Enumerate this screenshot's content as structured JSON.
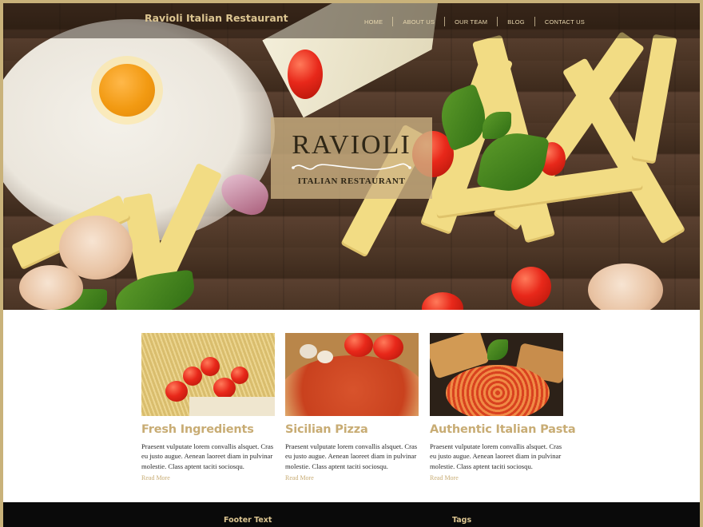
{
  "header": {
    "site_title": "Ravioli Italian Restaurant",
    "nav": [
      "HOME",
      "ABOUT US",
      "OUR TEAM",
      "BLOG",
      "CONTACT US"
    ]
  },
  "hero": {
    "logo_title": "RAVIOLI",
    "logo_subtitle": "ITALIAN RESTAURANT"
  },
  "cards": [
    {
      "title": "Fresh Ingredients",
      "text": "Praesent vulputate lorem convallis alsquet. Cras eu justo augue. Aenean laoreet diam in pulvinar molestie. Class aptent taciti sociosqu.",
      "link": "Read More"
    },
    {
      "title": "Sicilian Pizza",
      "text": "Praesent vulputate lorem convallis alsquet. Cras eu justo augue. Aenean laoreet diam in pulvinar molestie. Class aptent taciti sociosqu.",
      "link": "Read More"
    },
    {
      "title": "Authentic Italian Pasta",
      "text": "Praesent vulputate lorem convallis alsquet. Cras eu justo augue. Aenean laoreet diam in pulvinar molestie. Class aptent taciti sociosqu.",
      "link": "Read More"
    }
  ],
  "footer": {
    "col1_heading": "Footer Text",
    "col2_heading": "Tags"
  },
  "colors": {
    "accent": "#c8ac74",
    "frame": "#c9b27a",
    "footer_bg": "#0a0a0a"
  }
}
